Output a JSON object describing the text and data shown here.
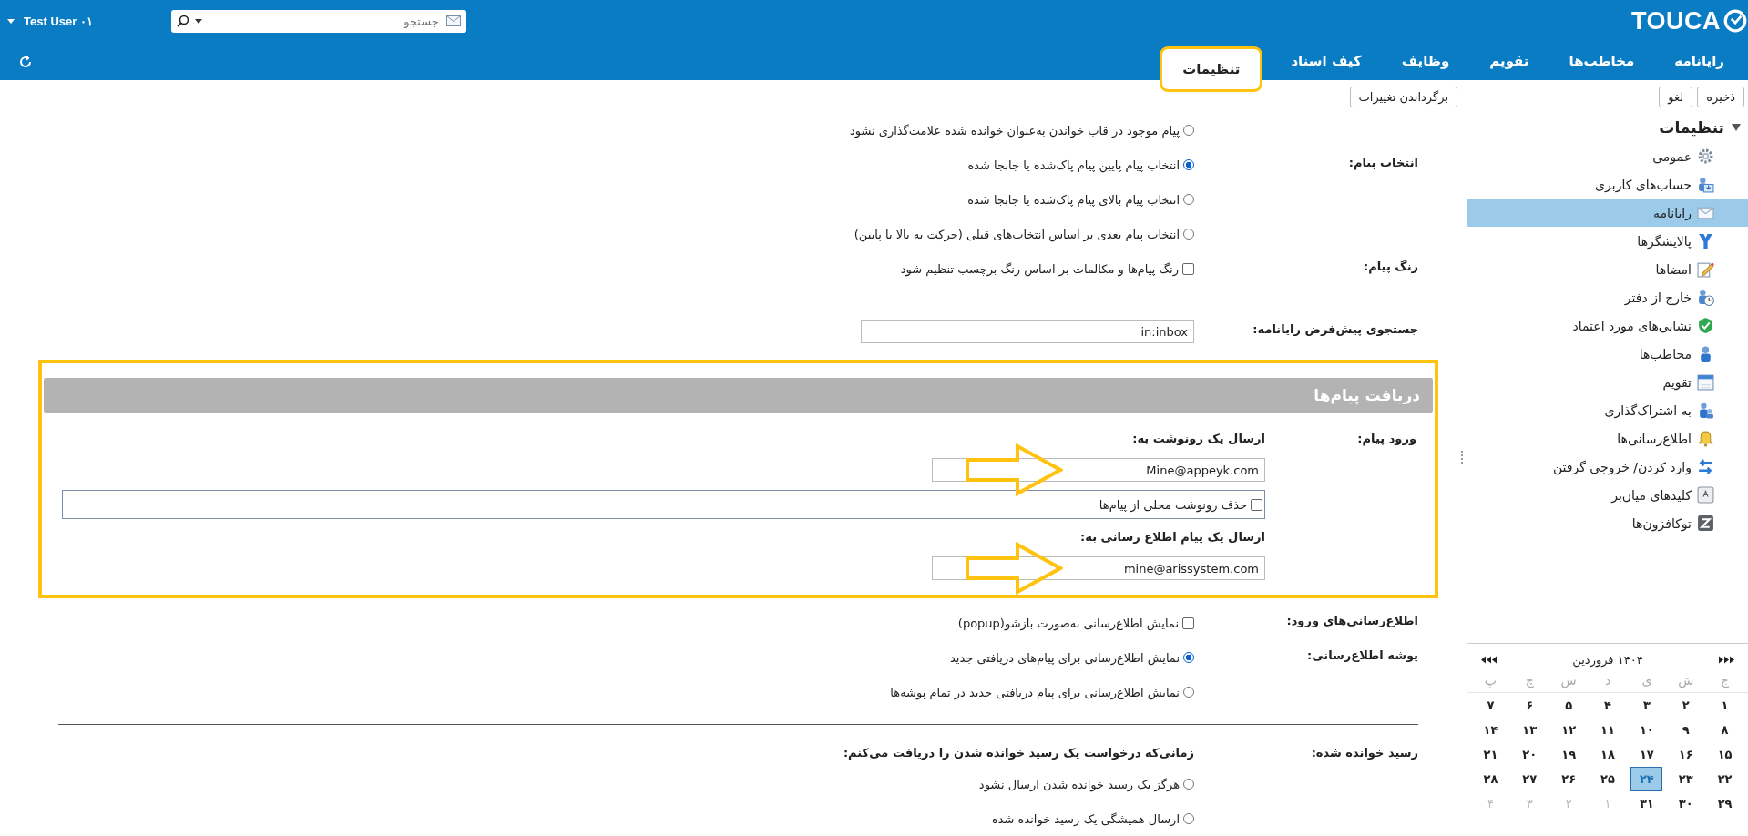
{
  "header": {
    "logo": "TOUCA",
    "search": {
      "placeholder": "جستجو"
    },
    "user": "Test User ۰۱"
  },
  "tabs": [
    {
      "label": "رایانامه",
      "selected": false,
      "highlighted": false
    },
    {
      "label": "مخاطب‌ها",
      "selected": false,
      "highlighted": false
    },
    {
      "label": "تقویم",
      "selected": false,
      "highlighted": false
    },
    {
      "label": "وظایف",
      "selected": false,
      "highlighted": false
    },
    {
      "label": "کیف اسناد",
      "selected": false,
      "highlighted": false
    },
    {
      "label": "تنظیمات",
      "selected": true,
      "highlighted": true
    }
  ],
  "sidebar_toolbar": [
    "ذخیره",
    "لغو"
  ],
  "content_toolbar": [
    "برگرداندن تغییرات"
  ],
  "sidebar": {
    "title": "تنظیمات",
    "expanded": true,
    "items": [
      {
        "label": "عمومی",
        "kind": "gear",
        "selected": false
      },
      {
        "label": "حساب‌های کاربری",
        "kind": "account",
        "selected": false
      },
      {
        "label": "رایانامه",
        "kind": "mail",
        "selected": true
      },
      {
        "label": "پالایشگرها",
        "kind": "filter",
        "selected": false
      },
      {
        "label": "امضاها",
        "kind": "signature",
        "selected": false
      },
      {
        "label": "خارج از دفتر",
        "kind": "clock",
        "selected": false
      },
      {
        "label": "نشانی‌های مورد اعتماد",
        "kind": "shield",
        "selected": false
      },
      {
        "label": "مخاطب‌ها",
        "kind": "person",
        "selected": false
      },
      {
        "label": "تقویم",
        "kind": "calendar",
        "selected": false
      },
      {
        "label": "به اشتراک‌گذاری",
        "kind": "people",
        "selected": false
      },
      {
        "label": "اطلاع‌رسانی‌ها",
        "kind": "bell",
        "selected": false
      },
      {
        "label": "وارد کردن/ خروجی گرفتن",
        "kind": "arrows",
        "selected": false
      },
      {
        "label": "کلیدهای میان‌بر",
        "kind": "key",
        "selected": false
      },
      {
        "label": "توکافزون‌ها",
        "kind": "zimlet",
        "selected": false
      }
    ]
  },
  "calendar": {
    "title": "۱۴۰۴ فروردین",
    "weekdays": [
      "ج",
      "ش",
      "ی",
      "د",
      "س",
      "چ",
      "پ"
    ],
    "weeks": [
      [
        {
          "day": "۱",
          "muted": false,
          "selected": false
        },
        {
          "day": "۲",
          "muted": false,
          "selected": false
        },
        {
          "day": "۳",
          "muted": false,
          "selected": false
        },
        {
          "day": "۴",
          "muted": false,
          "selected": false
        },
        {
          "day": "۵",
          "muted": false,
          "selected": false
        },
        {
          "day": "۶",
          "muted": false,
          "selected": false
        },
        {
          "day": "۷",
          "muted": false,
          "selected": false
        }
      ],
      [
        {
          "day": "۸",
          "muted": false,
          "selected": false
        },
        {
          "day": "۹",
          "muted": false,
          "selected": false
        },
        {
          "day": "۱۰",
          "muted": false,
          "selected": false
        },
        {
          "day": "۱۱",
          "muted": false,
          "selected": false
        },
        {
          "day": "۱۲",
          "muted": false,
          "selected": false
        },
        {
          "day": "۱۳",
          "muted": false,
          "selected": false
        },
        {
          "day": "۱۴",
          "muted": false,
          "selected": false
        }
      ],
      [
        {
          "day": "۱۵",
          "muted": false,
          "selected": false
        },
        {
          "day": "۱۶",
          "muted": false,
          "selected": false
        },
        {
          "day": "۱۷",
          "muted": false,
          "selected": false
        },
        {
          "day": "۱۸",
          "muted": false,
          "selected": false
        },
        {
          "day": "۱۹",
          "muted": false,
          "selected": false
        },
        {
          "day": "۲۰",
          "muted": false,
          "selected": false
        },
        {
          "day": "۲۱",
          "muted": false,
          "selected": false
        }
      ],
      [
        {
          "day": "۲۲",
          "muted": false,
          "selected": false
        },
        {
          "day": "۲۳",
          "muted": false,
          "selected": false
        },
        {
          "day": "۲۴",
          "muted": false,
          "selected": true
        },
        {
          "day": "۲۵",
          "muted": false,
          "selected": false
        },
        {
          "day": "۲۶",
          "muted": false,
          "selected": false
        },
        {
          "day": "۲۷",
          "muted": false,
          "selected": false
        },
        {
          "day": "۲۸",
          "muted": false,
          "selected": false
        }
      ],
      [
        {
          "day": "۲۹",
          "muted": false,
          "selected": false
        },
        {
          "day": "۳۰",
          "muted": false,
          "selected": false
        },
        {
          "day": "۳۱",
          "muted": false,
          "selected": false
        },
        {
          "day": "۱",
          "muted": true,
          "selected": false
        },
        {
          "day": "۲",
          "muted": true,
          "selected": false
        },
        {
          "day": "۳",
          "muted": true,
          "selected": false
        },
        {
          "day": "۴",
          "muted": true,
          "selected": false
        }
      ]
    ]
  },
  "content": [
    {
      "kind": "group",
      "rows": [
        {
          "controls": [
            {
              "kind": "radio",
              "text": "پیام موجود در قاب خواندن به‌عنوان خوانده شده علامت‌گذاری نشود",
              "selected": false
            }
          ]
        },
        {
          "label": "انتخاب پیام:",
          "controls": [
            {
              "kind": "radio",
              "text": "انتخاب پیام پایین پیام پاک‌شده یا جابجا شده",
              "selected": true
            },
            {
              "kind": "radio",
              "text": "انتخاب پیام بالای پیام پاک‌شده یا جابجا شده",
              "selected": false
            },
            {
              "kind": "radio",
              "text": "انتخاب پیام بعدی بر اساس انتخاب‌های قبلی (حرکت به بالا یا پایین)",
              "selected": false
            }
          ]
        },
        {
          "label": "رنگ پیام:",
          "controls": [
            {
              "kind": "checkbox",
              "text": "رنگ پیام‌ها و مکالمات بر اساس رنگ برچسب تنظیم شود",
              "checked": false
            }
          ]
        }
      ]
    },
    {
      "kind": "rule"
    },
    {
      "kind": "group",
      "rows": [
        {
          "label": "جستجوی پیش‌فرض رایانامه:",
          "controls": [
            {
              "kind": "field",
              "value": "in:inbox",
              "arrow": false
            }
          ]
        }
      ]
    },
    {
      "kind": "section",
      "title": "دریافت پیام‌ها",
      "highlighted": true,
      "rows": [
        {
          "label": "ورود پیام:",
          "controls": [
            {
              "kind": "heading",
              "text": "ارسال یک رونوشت به:"
            },
            {
              "kind": "field",
              "value": "Mine@appeyk.com",
              "arrow": true
            },
            {
              "kind": "boxed_checkbox",
              "text": "حذف رونوشت محلی از پیام‌ها",
              "checked": false
            },
            {
              "kind": "heading",
              "text": "ارسال یک پیام اطلاع رسانی به:"
            },
            {
              "kind": "field",
              "value": "mine@arissystem.com",
              "arrow": true
            }
          ]
        }
      ]
    },
    {
      "kind": "group",
      "rows": [
        {
          "label": "اطلاع‌رسانی‌های ورود:",
          "controls": [
            {
              "kind": "checkbox",
              "text": "نمایش اطلاع‌رسانی به‌صورت بازشو(popup)",
              "checked": false
            }
          ]
        },
        {
          "label": "پوشه اطلاع‌رسانی:",
          "controls": [
            {
              "kind": "radio",
              "text": "نمایش اطلاع‌رسانی برای پیام‌های دریافتی جدید",
              "selected": true
            },
            {
              "kind": "radio",
              "text": "نمایش اطلاع‌رسانی برای پیام دریافتی جدید در تمام پوشه‌ها",
              "selected": false
            }
          ]
        }
      ]
    },
    {
      "kind": "rule"
    },
    {
      "kind": "group",
      "rows": [
        {
          "label": "رسید خوانده شده:",
          "controls": [
            {
              "kind": "heading",
              "text": "زمانی‌که درخواست یک رسید خوانده شدن را دریافت می‌کنم:"
            },
            {
              "kind": "radio",
              "text": "هرگز یک رسید خوانده شدن ارسال نشود",
              "selected": false
            },
            {
              "kind": "radio",
              "text": "ارسال همیشگی یک رسید خوانده شده",
              "selected": false
            }
          ]
        }
      ]
    }
  ]
}
